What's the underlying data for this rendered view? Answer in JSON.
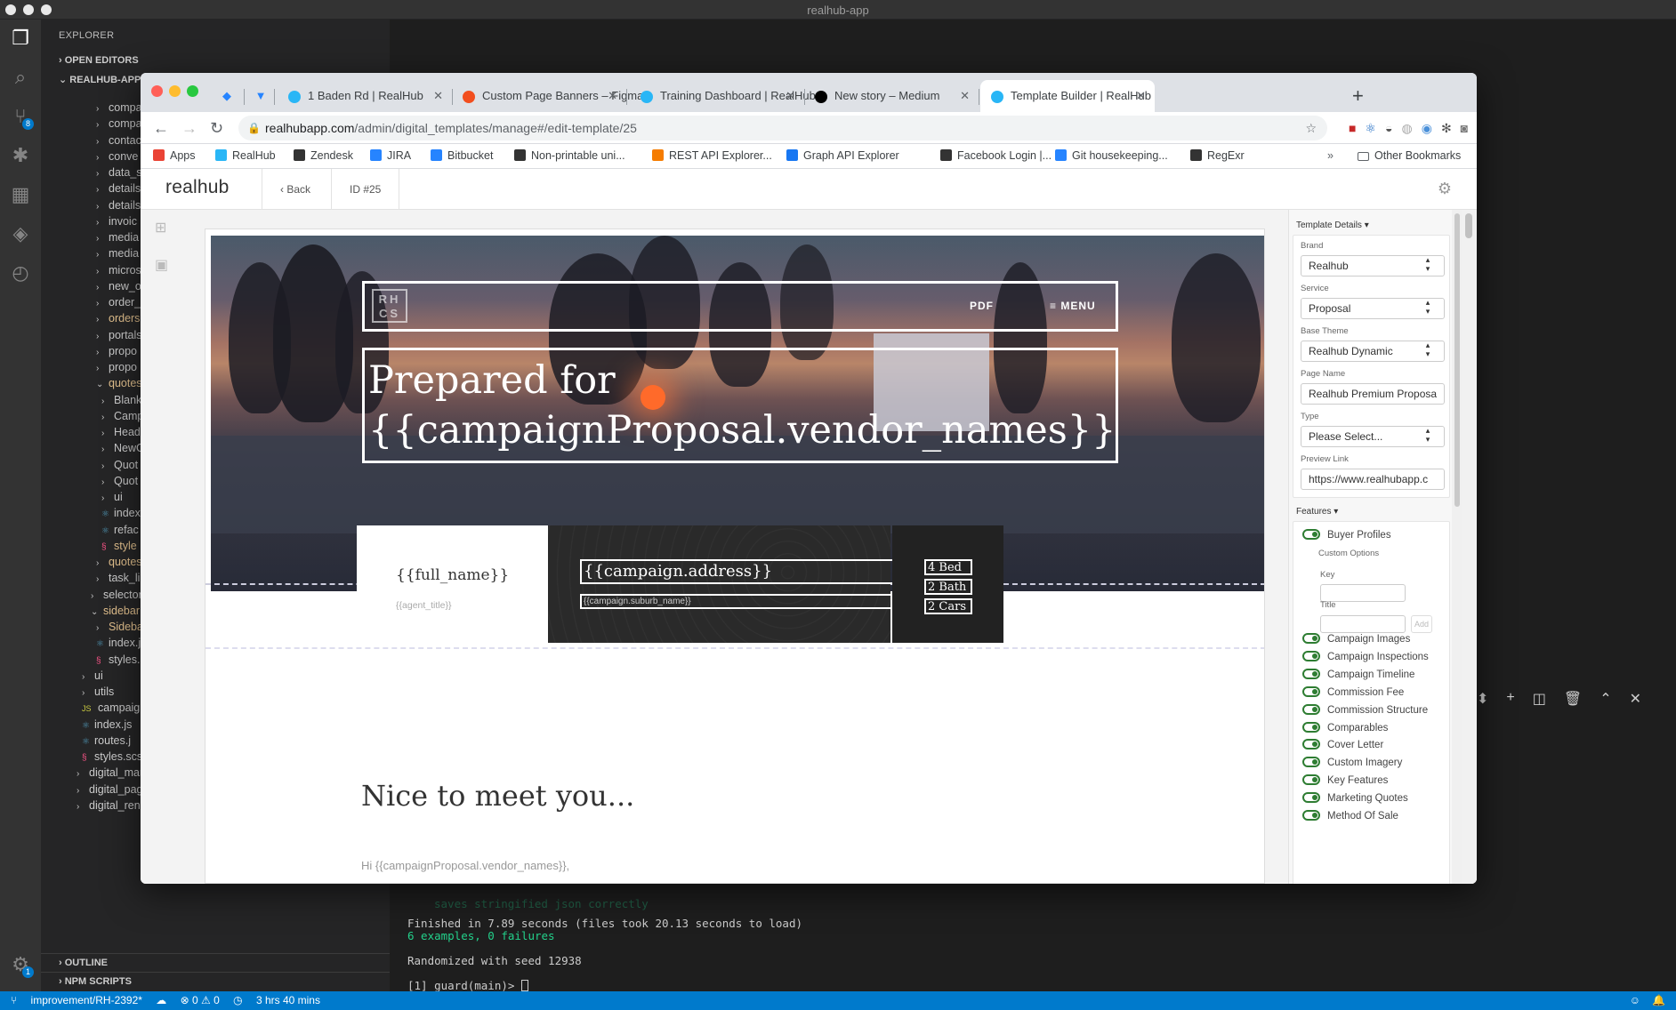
{
  "window_title": "realhub-app",
  "explorer": {
    "title": "EXPLORER",
    "open_editors": "OPEN EDITORS",
    "project": "REALHUB-APP",
    "items": [
      {
        "label": "compa",
        "indent": 1,
        "chev": "›"
      },
      {
        "label": "compa",
        "indent": 1,
        "chev": "›"
      },
      {
        "label": "contac",
        "indent": 1,
        "chev": "›"
      },
      {
        "label": "conve",
        "indent": 1,
        "chev": "›"
      },
      {
        "label": "data_s",
        "indent": 1,
        "chev": "›"
      },
      {
        "label": "details",
        "indent": 1,
        "chev": "›"
      },
      {
        "label": "details",
        "indent": 1,
        "chev": "›"
      },
      {
        "label": "invoic",
        "indent": 1,
        "chev": "›"
      },
      {
        "label": "media",
        "indent": 1,
        "chev": "›"
      },
      {
        "label": "media",
        "indent": 1,
        "chev": "›"
      },
      {
        "label": "micros",
        "indent": 1,
        "chev": "›"
      },
      {
        "label": "new_o",
        "indent": 1,
        "chev": "›"
      },
      {
        "label": "order_",
        "indent": 1,
        "chev": "›"
      },
      {
        "label": "orders",
        "indent": 1,
        "chev": "›",
        "orange": true
      },
      {
        "label": "portals",
        "indent": 1,
        "chev": "›"
      },
      {
        "label": "propo",
        "indent": 1,
        "chev": "›"
      },
      {
        "label": "propo",
        "indent": 1,
        "chev": "›"
      },
      {
        "label": "quotes",
        "indent": 1,
        "chev": "⌄",
        "orange": true
      },
      {
        "label": "Blank",
        "indent": 2,
        "chev": "›"
      },
      {
        "label": "Camp",
        "indent": 2,
        "chev": "›"
      },
      {
        "label": "Head",
        "indent": 2,
        "chev": "›"
      },
      {
        "label": "NewC",
        "indent": 2,
        "chev": "›"
      },
      {
        "label": "Quot",
        "indent": 2,
        "chev": "›"
      },
      {
        "label": "Quot",
        "indent": 2,
        "chev": "›"
      },
      {
        "label": "ui",
        "indent": 2,
        "chev": "›"
      },
      {
        "label": "index",
        "indent": 2,
        "chev": "⚛"
      },
      {
        "label": "refac",
        "indent": 2,
        "chev": "⚛"
      },
      {
        "label": "style",
        "indent": 2,
        "chev": "§",
        "orange": true
      },
      {
        "label": "quotes",
        "indent": 1,
        "chev": "›",
        "orange": true
      },
      {
        "label": "task_li",
        "indent": 1,
        "chev": "›"
      },
      {
        "label": "selector",
        "indent": 0,
        "chev": "›"
      },
      {
        "label": "sidebar",
        "indent": 0,
        "chev": "⌄",
        "orange": true
      },
      {
        "label": "Sideba",
        "indent": 1,
        "chev": "›",
        "orange": true
      },
      {
        "label": "index.j",
        "indent": 1,
        "chev": "⚛"
      },
      {
        "label": "styles.",
        "indent": 1,
        "chev": "§"
      },
      {
        "label": "ui",
        "indent": -1,
        "chev": "›"
      },
      {
        "label": "utils",
        "indent": -1,
        "chev": "›"
      },
      {
        "label": "campaig",
        "indent": -1,
        "chev": "JS"
      },
      {
        "label": "index.js",
        "indent": -1,
        "chev": "⚛"
      },
      {
        "label": "routes.j",
        "indent": -1,
        "chev": "⚛"
      },
      {
        "label": "styles.scss",
        "indent": -1,
        "chev": "§"
      },
      {
        "label": "digital_marketing",
        "indent": -2,
        "chev": "›"
      },
      {
        "label": "digital_page_manager",
        "indent": -2,
        "chev": "›"
      },
      {
        "label": "digital_renderer",
        "indent": -2,
        "chev": "›"
      }
    ],
    "outline": "OUTLINE",
    "npm_scripts": "NPM SCRIPTS",
    "scm_badge": "8",
    "settings_badge": "1"
  },
  "terminal": {
    "line_faint": "saves stringified json correctly",
    "line1": "Finished in 7.89 seconds (files took 20.13 seconds to load)",
    "line2": "6 examples, 0 failures",
    "line3": "Randomized with seed 12938",
    "prompt": "[1] guard(main)> "
  },
  "statusbar": {
    "branch": "improvement/RH-2392*",
    "problems": "⊗ 0  ⚠ 0",
    "time": "3 hrs 40 mins"
  },
  "browser": {
    "tabs": [
      {
        "title": "1 Baden Rd | RealHub",
        "color": "#29b6f6"
      },
      {
        "title": "Custom Page Banners – Figma",
        "color": "#f24e1e"
      },
      {
        "title": "Training Dashboard | RealHub",
        "color": "#29b6f6"
      },
      {
        "title": "New story – Medium",
        "color": "#000000"
      },
      {
        "title": "Template Builder | RealHub",
        "color": "#29b6f6"
      }
    ],
    "url_host": "realhubapp.com",
    "url_path": "/admin/digital_templates/manage#/edit-template/25",
    "bookmarks": [
      {
        "label": "Apps",
        "color": "#ea4335"
      },
      {
        "label": "RealHub",
        "color": "#29b6f6"
      },
      {
        "label": "Zendesk",
        "color": "#333333"
      },
      {
        "label": "JIRA",
        "color": "#2684ff"
      },
      {
        "label": "Bitbucket",
        "color": "#2684ff"
      },
      {
        "label": "Non-printable uni...",
        "color": "#333333"
      },
      {
        "label": "REST API Explorer...",
        "color": "#f57c00"
      },
      {
        "label": "Graph API Explorer",
        "color": "#1877f2"
      },
      {
        "label": "Facebook Login |...",
        "color": "#333333"
      },
      {
        "label": "Git housekeeping...",
        "color": "#2684ff"
      },
      {
        "label": "RegExr",
        "color": "#333333"
      }
    ],
    "other_bookmarks": "Other Bookmarks"
  },
  "app": {
    "logo": "realhub",
    "back": "Back",
    "id": "ID #25",
    "hero": {
      "logo_text": "RH CS",
      "pdf": "PDF",
      "menu": "≡ MENU",
      "title_line1": "Prepared for",
      "title_line2": "{{campaignProposal.vendor_names}}"
    },
    "agent": {
      "full_name": "{{full_name}}",
      "agent_title": "{{agent_title}}"
    },
    "address": {
      "line1": "{{campaign.address}}",
      "line2": "{{campaign.suburb_name}}"
    },
    "stats": [
      "4 Bed",
      "2 Bath",
      "2 Cars"
    ],
    "nice": "Nice to meet you...",
    "hi": "Hi {{campaignProposal.vendor_names}},"
  },
  "panel": {
    "template_details": "Template Details ▾",
    "fields": [
      {
        "label": "Brand",
        "value": "Realhub",
        "select": true
      },
      {
        "label": "Service",
        "value": "Proposal",
        "select": true
      },
      {
        "label": "Base Theme",
        "value": "Realhub Dynamic",
        "select": true
      },
      {
        "label": "Page Name",
        "value": "Realhub Premium Proposa",
        "select": false
      },
      {
        "label": "Type",
        "value": "Please Select...",
        "select": true
      },
      {
        "label": "Preview Link",
        "value": "https://www.realhubapp.c",
        "select": false
      }
    ],
    "features_title": "Features ▾",
    "custom_options": "Custom Options",
    "key_label": "Key",
    "title_label": "Title",
    "add": "Add",
    "features": [
      "Buyer Profiles",
      "Campaign Images",
      "Campaign Inspections",
      "Campaign Timeline",
      "Commission Fee",
      "Commission Structure",
      "Comparables",
      "Cover Letter",
      "Custom Imagery",
      "Key Features",
      "Marketing Quotes",
      "Method Of Sale"
    ]
  }
}
